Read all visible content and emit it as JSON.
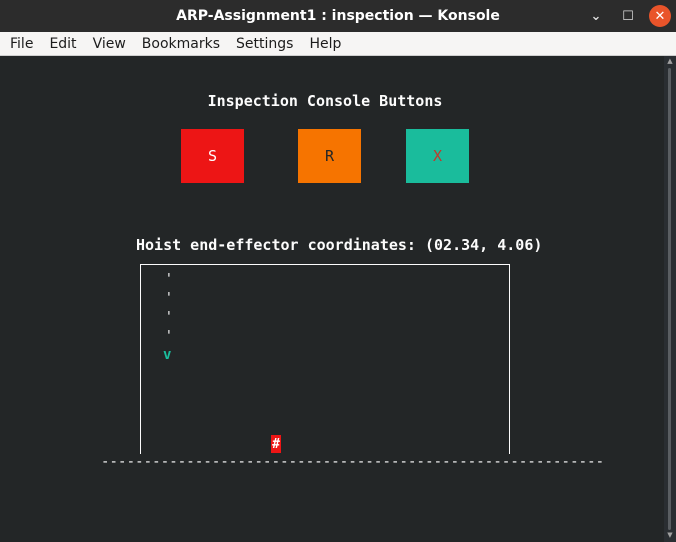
{
  "window": {
    "title": "ARP-Assignment1 : inspection — Konsole",
    "minimize_glyph": "⌄",
    "maximize_glyph": "☐",
    "close_glyph": "✕"
  },
  "menu": {
    "items": [
      "File",
      "Edit",
      "View",
      "Bookmarks",
      "Settings",
      "Help"
    ]
  },
  "terminal": {
    "heading": "Inspection Console Buttons",
    "buttons": [
      {
        "label": "S",
        "bg": "#ed1515",
        "fg": "#ffffff"
      },
      {
        "label": "R",
        "bg": "#f67400",
        "fg": "#232627"
      },
      {
        "label": "X",
        "bg": "#1abc9c",
        "fg": "#c0392b"
      }
    ],
    "coords_prefix": "Hoist end-effector coordinates: ",
    "coords_value": "(02.34, 4.06)",
    "hoist": {
      "rope_segments": [
        "'",
        "'",
        "'",
        "'"
      ],
      "hook_char": "v",
      "load_char": "#",
      "floor": "-----------------------------------------------------------"
    }
  },
  "colors": {
    "terminal_bg": "#232627",
    "text": "#fcfcfc",
    "hook": "#1abc9c",
    "load_bg": "#ed1515"
  },
  "icons": {
    "scroll_up": "▲",
    "scroll_down": "▼"
  }
}
